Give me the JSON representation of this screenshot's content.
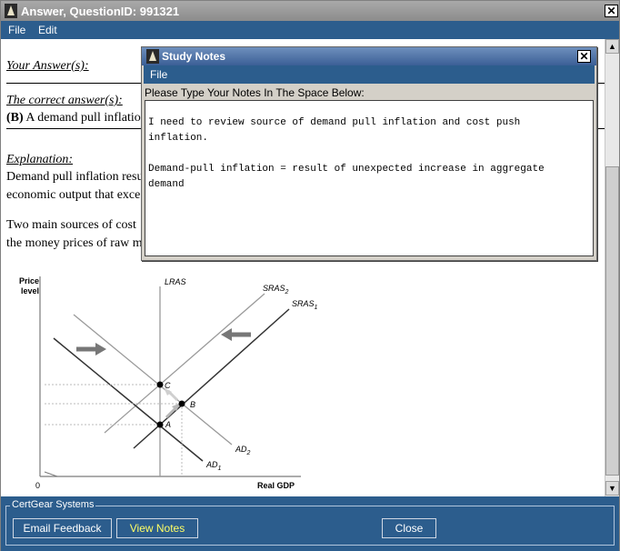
{
  "window": {
    "title": "Answer, QuestionID: 991321",
    "close_symbol": "✕"
  },
  "menu": {
    "file": "File",
    "edit": "Edit"
  },
  "content": {
    "your_answer_label": "Your Answer(s):",
    "correct_answer_label": "The correct answer(s):",
    "correct_answer_letter": "(B)",
    "correct_answer_text": "A demand pull inflatio",
    "explanation_label": "Explanation:",
    "explanation_line1": "Demand pull inflation resu",
    "explanation_line2": "economic output that exce",
    "sources_line1": "Two main sources of cost",
    "sources_line2": "the money prices of raw m"
  },
  "chart_data": {
    "type": "diagram",
    "y_label_line1": "Price",
    "y_label_line2": "level",
    "x_label": "Real GDP",
    "origin_label": "0",
    "curves": [
      "LRAS",
      "SRAS2",
      "SRAS1",
      "AD2",
      "AD1"
    ],
    "points": [
      "A",
      "B",
      "C"
    ]
  },
  "notes": {
    "title": "Study Notes",
    "menu_file": "File",
    "prompt": "Please Type Your Notes In The Space Below:",
    "text": "I need to review source of demand pull inflation and cost push\ninflation.\n\nDemand-pull inflation = result of unexpected increase in aggregate\ndemand"
  },
  "footer": {
    "group_label": "CertGear Systems",
    "email_button": "Email Feedback",
    "notes_button": "View Notes",
    "close_button": "Close",
    "notes_button_color": "#ffff66"
  },
  "scrollbar": {
    "up": "▲",
    "down": "▼"
  }
}
